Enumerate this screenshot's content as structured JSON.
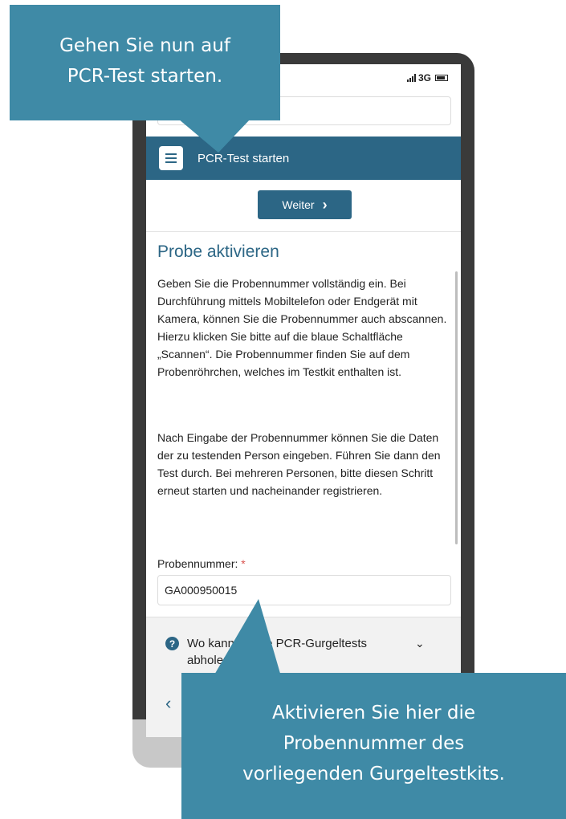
{
  "status_bar": {
    "network": "3G"
  },
  "nav": {
    "title": "PCR-Test starten"
  },
  "weiter_button": {
    "label": "Weiter",
    "icon": "chevron-right-icon"
  },
  "section": {
    "heading": "Probe aktivieren",
    "paragraph_1": "Geben Sie die Probennummer vollständig ein. Bei Durchführung mittels Mobiltelefon oder Endgerät mit Kamera, können Sie die Probennummer auch abscannen. Hierzu klicken Sie bitte auf die blaue Schaltfläche „Scannen“. Die Probennummer finden Sie auf dem Probenröhrchen, welches im Testkit enthalten ist.",
    "paragraph_2": "Nach Eingabe der Probennummer können Sie die Daten der zu testenden Person eingeben. Führen Sie dann den Test durch. Bei mehreren Personen, bitte diesen Schritt erneut starten und nacheinander registrieren."
  },
  "form": {
    "sample_label": "Probennummer:",
    "required_marker": "*",
    "sample_value": "GA000950015"
  },
  "faq": {
    "question": "Wo kann ich die PCR-Gurgeltests abholen?"
  },
  "callouts": {
    "top": [
      "Gehen Sie nun auf",
      "PCR-Test starten."
    ],
    "bottom": [
      "Aktivieren Sie hier die",
      "Probennummer des",
      "vorliegenden Gurgeltestkits."
    ]
  },
  "colors": {
    "primary": "#2c6685",
    "callout": "#3f8aa6",
    "required": "#d9534f"
  }
}
